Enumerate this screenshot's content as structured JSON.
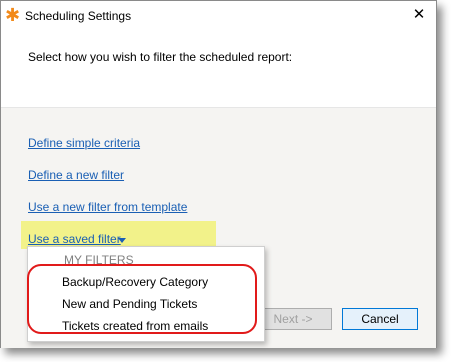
{
  "window": {
    "title": "Scheduling Settings",
    "app_icon": "asterisk-icon",
    "close_glyph": "✕"
  },
  "header": {
    "instruction": "Select how you wish to filter the scheduled report:"
  },
  "options": {
    "define_simple": "Define simple criteria",
    "define_new": "Define a new filter",
    "use_template": "Use a new filter from template",
    "use_saved": "Use a saved filter"
  },
  "dropdown": {
    "header": "MY FILTERS",
    "items": [
      "Backup/Recovery Category",
      "New and Pending Tickets",
      "Tickets created from emails"
    ]
  },
  "buttons": {
    "next": "Next ->",
    "cancel": "Cancel"
  },
  "colors": {
    "link": "#1a5fb4",
    "highlight": "#f2f28a",
    "annotation": "#e11a1a",
    "app_icon": "#f28a1a"
  }
}
